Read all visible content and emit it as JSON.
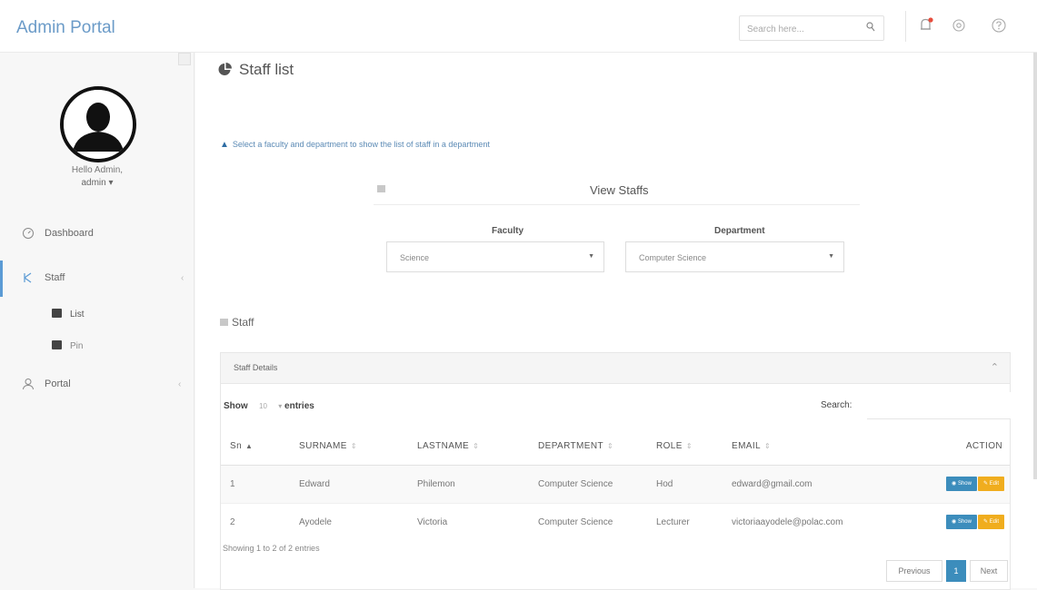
{
  "app": {
    "title": "Admin Portal"
  },
  "topbar": {
    "search_placeholder": "Search here...",
    "icons": [
      "search-icon",
      "bell-icon",
      "gear-icon",
      "help-icon"
    ]
  },
  "sidebar": {
    "greeting": "Hello Admin,",
    "username": "admin ▾",
    "items": [
      {
        "label": "Dashboard",
        "icon": "dashboard-icon"
      },
      {
        "label": "Staff",
        "icon": "staff-icon",
        "chevron": "‹",
        "sub": [
          "List",
          "Pin"
        ]
      },
      {
        "label": "Portal",
        "icon": "user-icon",
        "chevron": "‹"
      }
    ]
  },
  "main": {
    "title": "Staff list",
    "alert": "Select a faculty and department to show the list of staff in a department",
    "view_title": "View Staffs",
    "faculty_label": "Faculty",
    "faculty_value": "Science",
    "department_label": "Department",
    "department_value": "Computer Science",
    "staff_heading": "Staff",
    "panel_title": "Staff Details"
  },
  "table": {
    "show_label": "Show",
    "entries_value": "10",
    "entries_label": "entries",
    "search_label": "Search:",
    "columns": [
      "Sn",
      "SURNAME",
      "LASTNAME",
      "DEPARTMENT",
      "ROLE",
      "EMAIL",
      "ACTION"
    ],
    "rows": [
      {
        "sn": "1",
        "surname": "Edward",
        "lastname": "Philemon",
        "department": "Computer Science",
        "role": "Hod",
        "email": "edward@gmail.com"
      },
      {
        "sn": "2",
        "surname": "Ayodele",
        "lastname": "Victoria",
        "department": "Computer Science",
        "role": "Lecturer",
        "email": "victoriaayodele@polac.com"
      }
    ],
    "show_btn": "Show",
    "edit_btn": "Edit",
    "info": "Showing 1 to 2 of 2 entries",
    "previous": "Previous",
    "page": "1",
    "next": "Next"
  },
  "colors": {
    "brand": "#6b9bc8",
    "primary": "#3c8dbc",
    "warning": "#f0ad1e"
  }
}
